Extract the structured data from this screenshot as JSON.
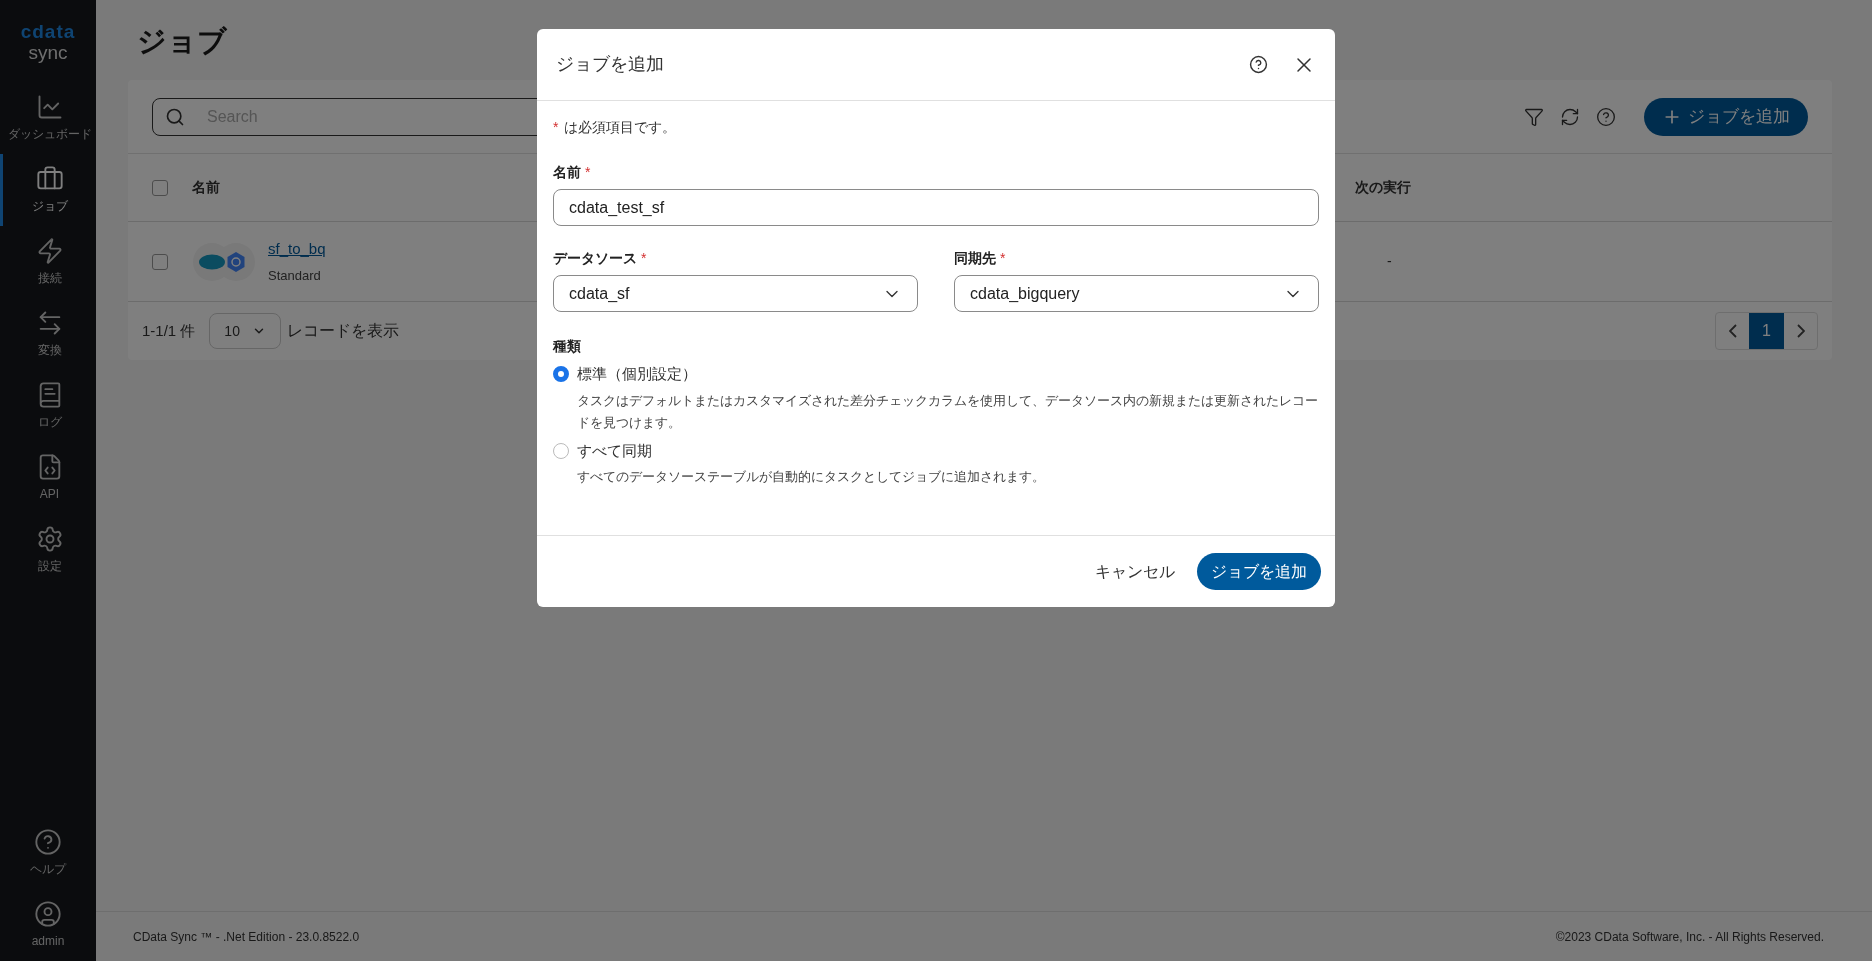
{
  "sidebar": {
    "logo": "cdata",
    "product": "sync",
    "items": [
      {
        "label": "ダッシュボード",
        "selected": false
      },
      {
        "label": "ジョブ",
        "selected": true
      },
      {
        "label": "接続",
        "selected": false
      },
      {
        "label": "変換",
        "selected": false
      },
      {
        "label": "ログ",
        "selected": false
      },
      {
        "label": "API",
        "selected": false
      },
      {
        "label": "設定",
        "selected": false
      }
    ],
    "bottom_items": [
      {
        "label": "ヘルプ"
      },
      {
        "label": "admin"
      }
    ]
  },
  "page_title": "ジョブ",
  "toolbar": {
    "search_placeholder": "Search",
    "add_button": "ジョブを追加"
  },
  "table": {
    "header_checked": false,
    "columns": [
      "名前",
      "次の実行"
    ],
    "rows": [
      {
        "name": "sf_to_bq",
        "type": "Standard",
        "next_run": "-",
        "checked": false
      }
    ]
  },
  "pagination": {
    "summary": "1-1/1 件",
    "page_size": "10",
    "page_size_label": "レコードを表示",
    "pages": [
      {
        "label": "1",
        "selected": true
      }
    ]
  },
  "footer": {
    "left": "CData Sync ™ - .Net Edition - 23.0.8522.0",
    "right": "©2023 CData Software, Inc. - All Rights Reserved."
  },
  "dialog": {
    "title": "ジョブを追加",
    "required_mark": "*",
    "required_note": "は必須項目です。",
    "name_field": {
      "label": "名前",
      "required": true,
      "value": "cdata_test_sf"
    },
    "source_field": {
      "label": "データソース",
      "required": true,
      "value": "cdata_sf"
    },
    "destination_field": {
      "label": "同期先",
      "required": true,
      "value": "cdata_bigquery"
    },
    "type_label": "種類",
    "type_options": [
      {
        "label": "標準（個別設定）",
        "description": "タスクはデフォルトまたはカスタマイズされた差分チェックカラムを使用して、データソース内の新規または更新されたレコードを見つけます。",
        "selected": true
      },
      {
        "label": "すべて同期",
        "description": "すべてのデータソーステーブルが自動的にタスクとしてジョブに追加されます。",
        "selected": false
      }
    ],
    "cancel_button": "キャンセル",
    "submit_button": "ジョブを追加"
  }
}
